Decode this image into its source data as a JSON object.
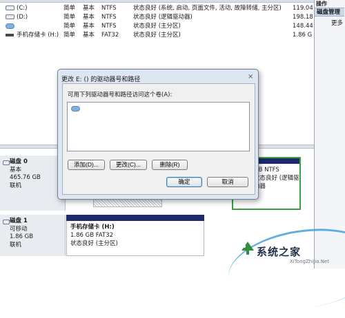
{
  "action_pane": {
    "header": "操作",
    "selected": "磁盘管理",
    "more": "更多"
  },
  "volumes": [
    {
      "icon": "drive-icon",
      "name": "(C:)",
      "layout": "简单",
      "type": "基本",
      "fs": "NTFS",
      "status": "状态良好 (系统, 启动, 页面文件, 活动, 故障转储, 主分区)",
      "capacity": "119.04"
    },
    {
      "icon": "drive-icon",
      "name": "(D:)",
      "layout": "简单",
      "type": "基本",
      "fs": "NTFS",
      "status": "状态良好 (逻辑驱动器)",
      "capacity": "198.18"
    },
    {
      "icon": "drive-blue-icon",
      "name": "",
      "layout": "简单",
      "type": "基本",
      "fs": "NTFS",
      "status": "状态良好 (主分区)",
      "capacity": "148.44"
    },
    {
      "icon": "memory-card-icon",
      "name": "手机存储卡 (H:)",
      "layout": "简单",
      "type": "基本",
      "fs": "FAT32",
      "status": "状态良好 (主分区)",
      "capacity": "1.86 G"
    }
  ],
  "disks": [
    {
      "title": "磁盘 0",
      "kind": "基本",
      "size": "465.76 GB",
      "state": "联机"
    },
    {
      "title": "磁盘 1",
      "kind": "可移动",
      "size": "1.86 GB",
      "state": "联机"
    }
  ],
  "disk0_partition_right": {
    "line1": "GB NTFS",
    "line2": "状态良好 (逻辑驱动器"
  },
  "disk1_partition": {
    "name": "手机存储卡 (H:)",
    "size": "1.86 GB FAT32",
    "status": "状态良好 (主分区)"
  },
  "dialog": {
    "title": "更改 E: () 的驱动器号和路径",
    "close": "×",
    "prompt": "可用下列驱动器号和路径访问这个卷(A):",
    "buttons": {
      "add": "添加(D)...",
      "change": "更改(C)...",
      "remove": "删除(R)",
      "ok": "确定",
      "cancel": "取消"
    }
  },
  "watermark": {
    "text": "系统之家",
    "sub": "XiTongZhiJia.Net"
  },
  "colors": {
    "volume_bar": "#1c2a6b",
    "selected_partition": "#3aa23a",
    "dialog_frame": "#dde6f1",
    "action_selected": "#c9d8ea"
  }
}
